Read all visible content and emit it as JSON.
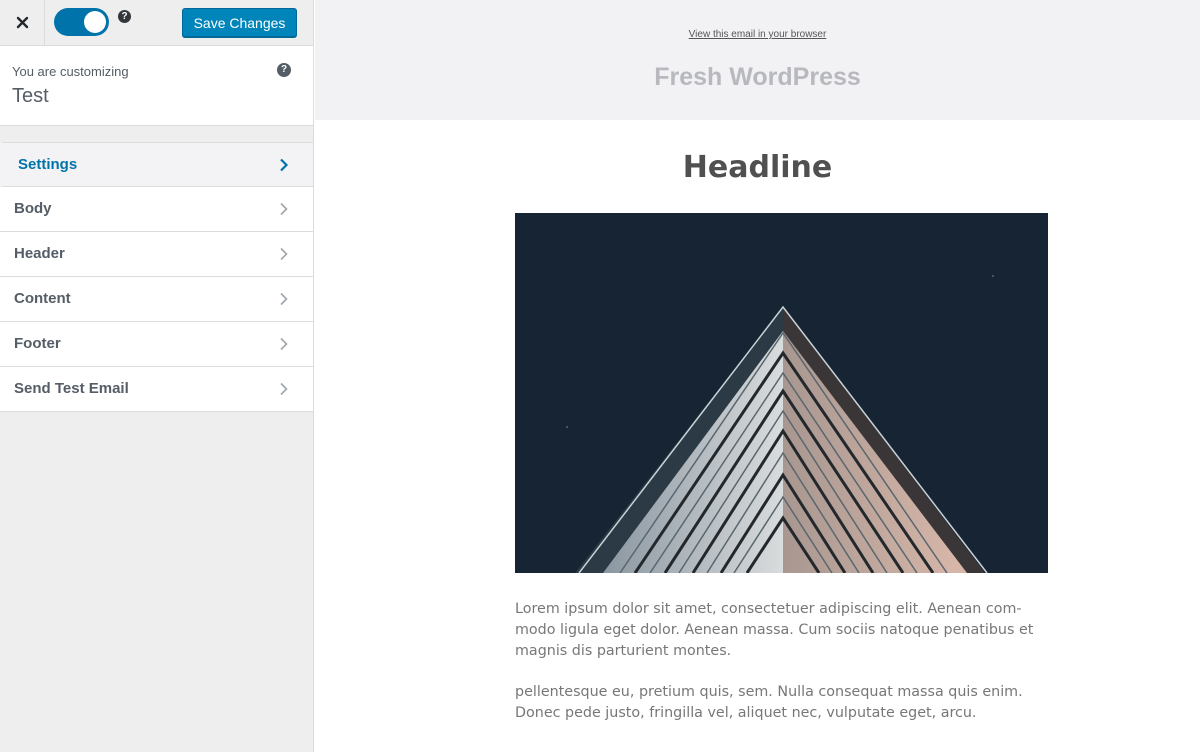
{
  "topbar": {
    "close_icon": "close-icon",
    "toggle_state": "on",
    "help_icon": "help-icon",
    "save_label": "Save Changes",
    "accent_color": "#0085ba"
  },
  "customizing": {
    "label": "You are customizing",
    "name": "Test",
    "help_icon": "help-icon"
  },
  "menu": {
    "items": [
      {
        "label": "Settings",
        "active": true
      },
      {
        "label": "Body",
        "active": false
      },
      {
        "label": "Header",
        "active": false
      },
      {
        "label": "Content",
        "active": false
      },
      {
        "label": "Footer",
        "active": false
      },
      {
        "label": "Send Test Email",
        "active": false
      }
    ],
    "chevron_icon": "chevron-right-icon"
  },
  "preview": {
    "view_in_browser": "View this email in your browser",
    "brand": "Fresh WordPress",
    "headline": "Headline",
    "hero_image": "building-pyramid-image",
    "paragraphs": [
      "Lorem ipsum dolor sit amet, consectetuer adipiscing elit. Aenean com-modo ligula eget dolor. Aenean massa. Cum sociis natoque penatibus et magnis dis parturient montes.",
      "pellentesque eu, pretium quis, sem. Nulla consequat massa quis enim. Donec pede justo, fringilla vel, aliquet nec, vulputate eget, arcu."
    ]
  }
}
